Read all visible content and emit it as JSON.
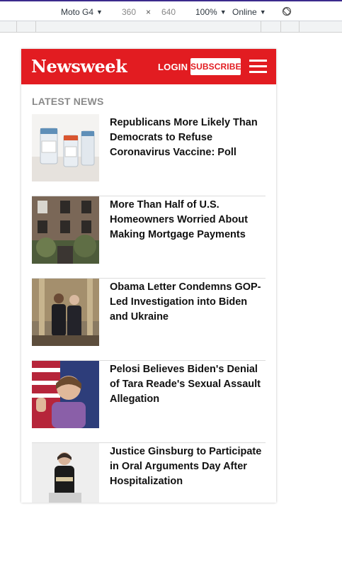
{
  "devtools": {
    "device": "Moto G4",
    "width": "360",
    "times": "×",
    "height": "640",
    "zoom": "100%",
    "network": "Online"
  },
  "site": {
    "logo": "Newsweek",
    "login": "LOGIN",
    "subscribe": "SUBSCRIBE",
    "brand_color": "#e21c21"
  },
  "section_title": "LATEST NEWS",
  "articles": [
    {
      "headline": "Republicans More Likely Than Democrats to Refuse Coronavirus Vaccine: Poll"
    },
    {
      "headline": "More Than Half of U.S. Homeowners Worried About Making Mortgage Payments"
    },
    {
      "headline": "Obama Letter Condemns GOP-Led Investigation into Biden and Ukraine"
    },
    {
      "headline": "Pelosi Believes Biden's Denial of Tara Reade's Sexual Assault Allegation"
    },
    {
      "headline": "Justice Ginsburg to Participate in Oral Arguments Day After Hospitalization"
    }
  ]
}
